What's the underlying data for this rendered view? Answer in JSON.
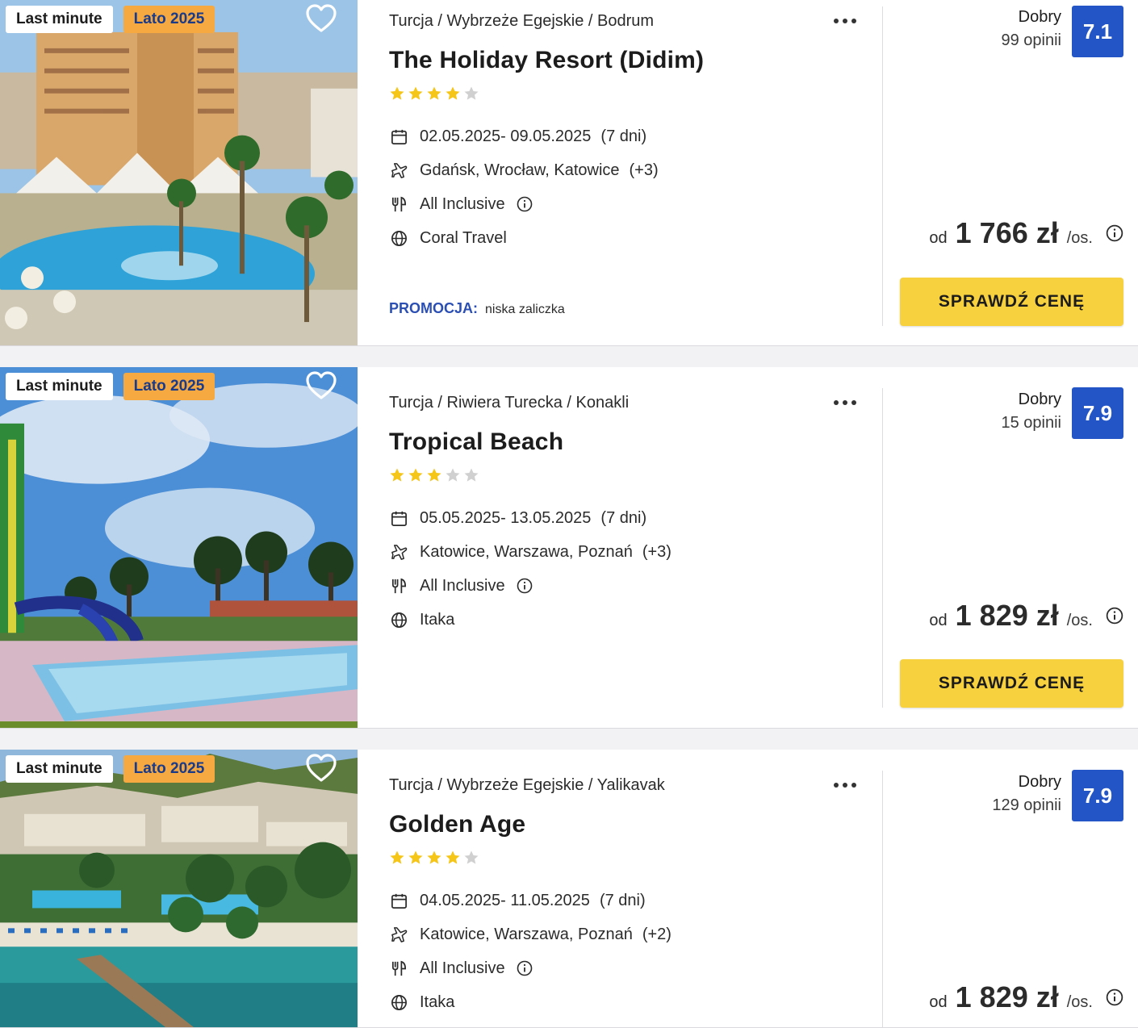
{
  "colors": {
    "badge_season": "#f5a940",
    "score": "#2355c7",
    "cta": "#f8d13f",
    "promo": "#2b4fb3",
    "star_on": "#f5c518",
    "star_off": "#d0d0d0"
  },
  "offers": [
    {
      "badges": [
        "Last minute",
        "Lato 2025"
      ],
      "breadcrumb": "Turcja / Wybrzeże Egejskie / Bodrum",
      "name": "The Holiday Resort (Didim)",
      "stars": 4,
      "dates": "02.05.2025- 09.05.2025",
      "duration": "(7 dni)",
      "airports": "Gdańsk, Wrocław, Katowice",
      "airports_more": "(+3)",
      "board": "All Inclusive",
      "operator": "Coral Travel",
      "promo_label": "PROMOCJA:",
      "promo_value": "niska zaliczka",
      "rating_word": "Dobry",
      "rating_count": "99 opinii",
      "score": "7.1",
      "price_prefix": "od",
      "price": "1 766 zł",
      "price_suffix": "/os.",
      "cta": "SPRAWDŹ CENĘ"
    },
    {
      "badges": [
        "Last minute",
        "Lato 2025"
      ],
      "breadcrumb": "Turcja / Riwiera Turecka / Konakli",
      "name": "Tropical Beach",
      "stars": 3,
      "dates": "05.05.2025- 13.05.2025",
      "duration": "(7 dni)",
      "airports": "Katowice, Warszawa, Poznań",
      "airports_more": "(+3)",
      "board": "All Inclusive",
      "operator": "Itaka",
      "rating_word": "Dobry",
      "rating_count": "15 opinii",
      "score": "7.9",
      "price_prefix": "od",
      "price": "1 829 zł",
      "price_suffix": "/os.",
      "cta": "SPRAWDŹ CENĘ"
    },
    {
      "badges": [
        "Last minute",
        "Lato 2025"
      ],
      "breadcrumb": "Turcja / Wybrzeże Egejskie / Yalikavak",
      "name": "Golden Age",
      "stars": 4,
      "dates": "04.05.2025- 11.05.2025",
      "duration": "(7 dni)",
      "airports": "Katowice, Warszawa, Poznań",
      "airports_more": "(+2)",
      "board": "All Inclusive",
      "operator": "Itaka",
      "rating_word": "Dobry",
      "rating_count": "129 opinii",
      "score": "7.9",
      "price_prefix": "od",
      "price": "1 829 zł",
      "price_suffix": "/os."
    }
  ]
}
